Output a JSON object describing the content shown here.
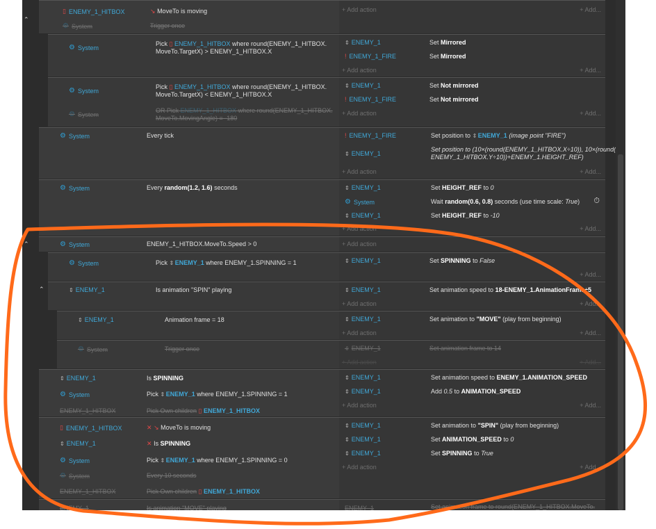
{
  "names": {
    "hitbox": "ENEMY_1_HITBOX",
    "enemy": "ENEMY_1",
    "fire": "ENEMY_1_FIRE",
    "system": "System"
  },
  "ui": {
    "add_action": "Add action",
    "add_more": "+ Add..."
  },
  "e1": {
    "c1": "MoveTo is moving",
    "c2": "Trigger once"
  },
  "e2": {
    "pick": "Pick",
    "cond_rest": "where round(ENEMY_1_HITBOX.",
    "cond_rest2": "MoveTo.TargetX) > ENEMY_1_HITBOX.X",
    "a1": "Set",
    "a1b": "Mirrored",
    "a2": "Set",
    "a2b": "Mirrored"
  },
  "e3": {
    "pick": "Pick",
    "cond_rest": "where round(ENEMY_1_HITBOX.",
    "cond_rest2": "MoveTo.TargetX) < ENEMY_1_HITBOX.X",
    "or": "OR Pick",
    "or_rest": "where round(ENEMY_1_HITBOX.",
    "or_rest2": "MoveTo.MovingAngle) = -180",
    "a1": "Set",
    "a1b": "Not mirrored",
    "a2": "Set",
    "a2b": "Not mirrored"
  },
  "e4": {
    "c1": "Every tick",
    "a1": "Set position to",
    "a1i": "(image point \"FIRE\")",
    "a2l1": "Set position to (10×(round(ENEMY_1_HITBOX.X÷10)), 10×(round(",
    "a2l2": "ENEMY_1_HITBOX.Y÷10))+ENEMY_1.HEIGHT_REF)"
  },
  "e5": {
    "c1a": "Every",
    "c1b": "random(1.2, 1.6)",
    "c1c": "seconds",
    "a1a": "Set",
    "a1b": "HEIGHT_REF",
    "a1c": "to",
    "a1d": "0",
    "a2a": "Wait",
    "a2b": "random(0.6, 0.8)",
    "a2c": "seconds (use time scale:",
    "a2d": "True",
    "a2e": ")",
    "a3a": "Set",
    "a3b": "HEIGHT_REF",
    "a3c": "to",
    "a3d": "-10"
  },
  "e6": {
    "c1": "ENEMY_1_HITBOX.MoveTo.Speed > 0"
  },
  "e7": {
    "pick": "Pick",
    "rest": "where ENEMY_1.SPINNING = 1",
    "a1a": "Set",
    "a1b": "SPINNING",
    "a1c": "to",
    "a1d": "False"
  },
  "e8": {
    "c1": "Is animation \"SPIN\" playing",
    "a1a": "Set animation speed to",
    "a1b": "18-ENEMY_1.AnimationFrame÷5"
  },
  "e9": {
    "c1": "Animation frame = 18",
    "a1a": "Set animation to",
    "a1b": "\"MOVE\"",
    "a1c": "(play from beginning)"
  },
  "e10": {
    "c1": "Trigger once",
    "a1": "Set animation frame to 14"
  },
  "e11": {
    "c1a": "Is",
    "c1b": "SPINNING",
    "pick": "Pick",
    "rest": "where ENEMY_1.SPINNING = 1",
    "pick_own": "Pick Own children",
    "a1a": "Set animation speed to",
    "a1b": "ENEMY_1.ANIMATION_SPEED",
    "a2a": "Add",
    "a2b": "0.5",
    "a2c": "to",
    "a2d": "ANIMATION_SPEED"
  },
  "e12": {
    "c1": "MoveTo is moving",
    "c2a": "Is",
    "c2b": "SPINNING",
    "pick": "Pick",
    "rest": "where ENEMY_1.SPINNING = 0",
    "every": "Every 10 seconds",
    "pick_own": "Pick Own children",
    "a1a": "Set animation to",
    "a1b": "\"SPIN\"",
    "a1c": "(play from beginning)",
    "a2a": "Set",
    "a2b": "ANIMATION_SPEED",
    "a2c": "to",
    "a2d": "0",
    "a3a": "Set",
    "a3b": "SPINNING",
    "a3c": "to",
    "a3d": "True"
  },
  "e13": {
    "c1": "Is animation \"MOVE\" playing",
    "a1": "Set animation frame to round(ENEMY_1_HITBOX.MoveTo."
  },
  "colors": {
    "object": "#40a8d8",
    "annotation": "#ff6a1a",
    "background": "#2c2c2c"
  }
}
